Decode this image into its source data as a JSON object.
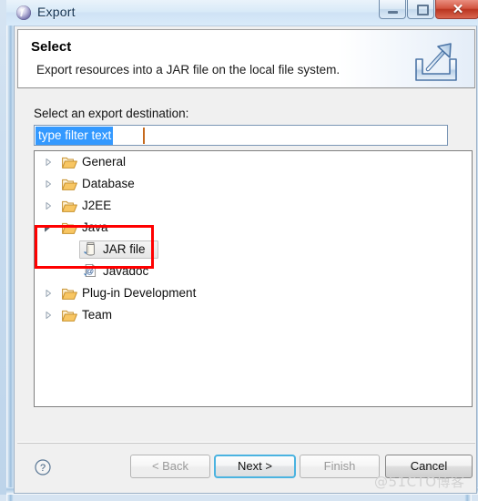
{
  "window": {
    "title": "Export",
    "icon": "eclipse-wizard-icon",
    "ghost_labels": [
      "",
      ""
    ],
    "controls": {
      "minimize": "minimize-button",
      "maximize": "restore-button",
      "close_label": "✕"
    }
  },
  "header": {
    "title": "Select",
    "description": "Export resources into a JAR file on the local file system.",
    "banner_icon": "export-arrow-icon"
  },
  "form": {
    "destination_label": "Select an export destination:",
    "filter": {
      "value": "type filter text",
      "placeholder": "type filter text",
      "selected": true
    }
  },
  "tree": {
    "items": [
      {
        "label": "General",
        "level": 0,
        "state": "collapsed",
        "icon": "folder-icon",
        "selected": false
      },
      {
        "label": "Database",
        "level": 0,
        "state": "collapsed",
        "icon": "folder-icon",
        "selected": false
      },
      {
        "label": "J2EE",
        "level": 0,
        "state": "collapsed",
        "icon": "folder-icon",
        "selected": false
      },
      {
        "label": "Java",
        "level": 0,
        "state": "expanded",
        "icon": "folder-icon",
        "selected": false
      },
      {
        "label": "JAR file",
        "level": 1,
        "state": "leaf",
        "icon": "jar-file-icon",
        "selected": true
      },
      {
        "label": "Javadoc",
        "level": 1,
        "state": "leaf",
        "icon": "javadoc-icon",
        "selected": false
      },
      {
        "label": "Plug-in Development",
        "level": 0,
        "state": "collapsed",
        "icon": "folder-icon",
        "selected": false
      },
      {
        "label": "Team",
        "level": 0,
        "state": "collapsed",
        "icon": "folder-icon",
        "selected": false
      }
    ]
  },
  "annotation": {
    "color": "#ff0000",
    "shape": "rectangle",
    "covers": [
      "Java",
      "JAR file"
    ]
  },
  "footer": {
    "help_icon": "help-question-icon",
    "buttons": [
      {
        "label": "< Back",
        "state": "disabled"
      },
      {
        "label": "Next >",
        "state": "default"
      },
      {
        "label": "Finish",
        "state": "disabled"
      },
      {
        "label": "Cancel",
        "state": "enabled"
      }
    ]
  },
  "watermark": {
    "text": "@51CTO博客"
  },
  "colors": {
    "selection_blue": "#3399ff",
    "annotation_red": "#ff0000",
    "default_button_focus": "#4ab3e0",
    "folder_orange": "#e9a33a"
  }
}
